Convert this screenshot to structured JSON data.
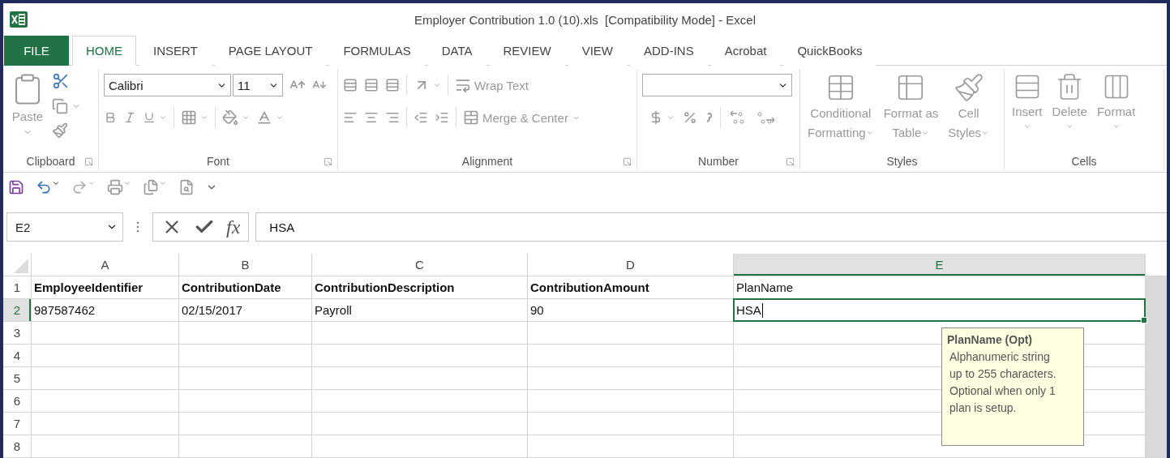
{
  "window": {
    "title": "Employer Contribution 1.0 (10).xls  [Compatibility Mode] - Excel"
  },
  "tabs": [
    {
      "label": "FILE",
      "kind": "file",
      "selected": false
    },
    {
      "label": "HOME",
      "kind": "tab",
      "selected": true
    },
    {
      "label": "INSERT",
      "kind": "tab",
      "selected": false
    },
    {
      "label": "PAGE LAYOUT",
      "kind": "tab",
      "selected": false
    },
    {
      "label": "FORMULAS",
      "kind": "tab",
      "selected": false
    },
    {
      "label": "DATA",
      "kind": "tab",
      "selected": false
    },
    {
      "label": "REVIEW",
      "kind": "tab",
      "selected": false
    },
    {
      "label": "VIEW",
      "kind": "tab",
      "selected": false
    },
    {
      "label": "ADD-INS",
      "kind": "tab",
      "selected": false
    },
    {
      "label": "Acrobat",
      "kind": "tab",
      "selected": false
    },
    {
      "label": "QuickBooks",
      "kind": "tab",
      "selected": false
    }
  ],
  "ribbon": {
    "disabled": true,
    "groups": [
      {
        "kind": "clipboard",
        "name": "Clipboard",
        "launcher": true,
        "paste_label": "Paste"
      },
      {
        "kind": "font",
        "name": "Font",
        "launcher": true,
        "font_name": "Calibri",
        "font_size": "11"
      },
      {
        "kind": "alignment",
        "name": "Alignment",
        "launcher": true,
        "wrap_label": "Wrap Text",
        "merge_label": "Merge & Center"
      },
      {
        "kind": "number",
        "name": "Number",
        "launcher": true
      },
      {
        "kind": "styles",
        "name": "Styles",
        "launcher": false,
        "buttons": [
          {
            "lines": [
              "Conditional",
              "Formatting"
            ]
          },
          {
            "lines": [
              "Format as",
              "Table"
            ]
          },
          {
            "lines": [
              "Cell",
              "Styles"
            ]
          }
        ]
      },
      {
        "kind": "cells",
        "name": "Cells",
        "launcher": false,
        "buttons": [
          {
            "label": "Insert"
          },
          {
            "label": "Delete"
          },
          {
            "label": "Format"
          }
        ]
      }
    ]
  },
  "formula_bar": {
    "name_box": "E2",
    "function_label": "fx",
    "value": "HSA"
  },
  "sheet": {
    "columns": [
      {
        "label": "A",
        "selected": false
      },
      {
        "label": "B",
        "selected": false
      },
      {
        "label": "C",
        "selected": false
      },
      {
        "label": "D",
        "selected": false
      },
      {
        "label": "E",
        "selected": true
      }
    ],
    "rows": [
      {
        "label": "1",
        "selected": false,
        "cells": [
          {
            "text": "EmployeeIdentifier",
            "bold": true
          },
          {
            "text": "ContributionDate",
            "bold": true
          },
          {
            "text": "ContributionDescription",
            "bold": true
          },
          {
            "text": "ContributionAmount",
            "bold": true
          },
          {
            "text": "PlanName",
            "bold": false
          }
        ]
      },
      {
        "label": "2",
        "selected": true,
        "cells": [
          {
            "text": "987587462",
            "bold": false
          },
          {
            "text": "02/15/2017",
            "bold": false
          },
          {
            "text": "Payroll",
            "bold": false
          },
          {
            "text": "90",
            "bold": false
          },
          {
            "text": "HSA",
            "bold": false
          }
        ]
      },
      {
        "label": "3",
        "selected": false
      },
      {
        "label": "4",
        "selected": false
      },
      {
        "label": "5",
        "selected": false
      },
      {
        "label": "6",
        "selected": false
      },
      {
        "label": "7",
        "selected": false
      },
      {
        "label": "8",
        "selected": false
      }
    ]
  },
  "tooltip": {
    "title": "PlanName (Opt)",
    "lines": [
      "Alphanumeric string",
      "up to 255 characters.",
      "Optional when only 1",
      "plan is setup."
    ]
  }
}
